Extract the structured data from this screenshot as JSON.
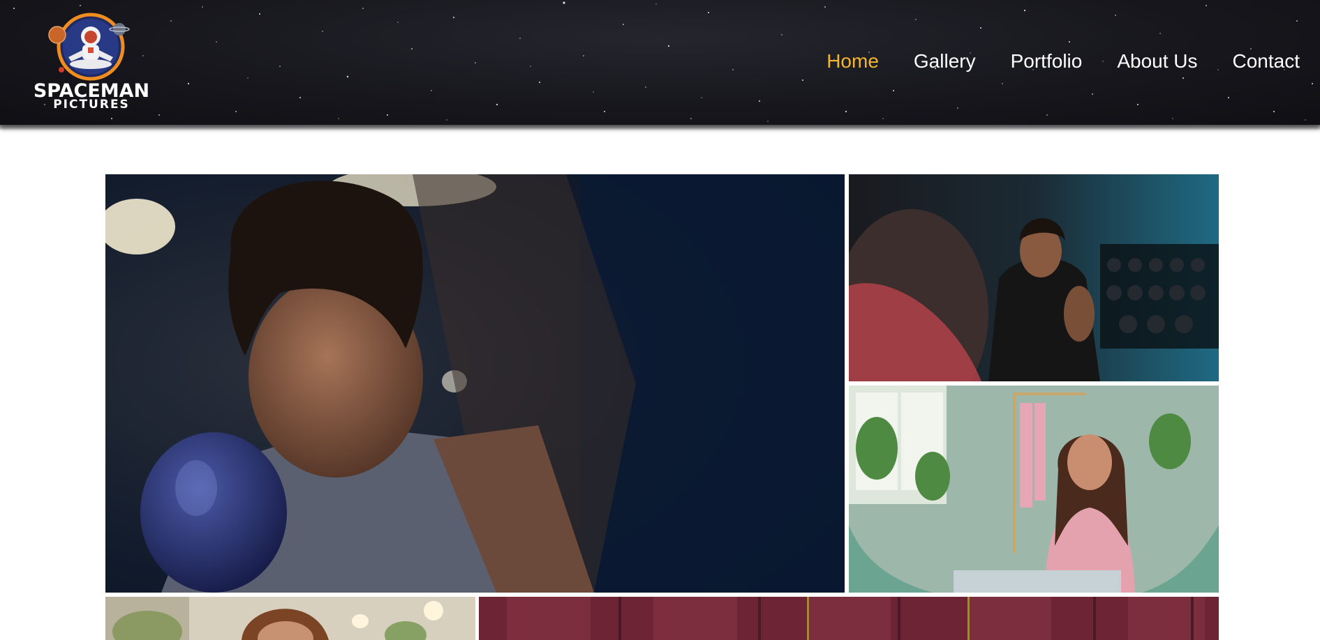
{
  "brand": {
    "name": "SPACEMAN",
    "tagline": "PICTURES",
    "accent_color": "#f4b531",
    "logo_icon": "astronaut-logo-icon"
  },
  "nav": {
    "active_color": "#f4b531",
    "items": [
      {
        "label": "Home",
        "active": true
      },
      {
        "label": "Gallery",
        "active": false
      },
      {
        "label": "Portfolio",
        "active": false
      },
      {
        "label": "About Us",
        "active": false
      },
      {
        "label": "Contact",
        "active": false
      }
    ]
  },
  "gallery": {
    "tiles": [
      {
        "subject": "boxer-with-blue-glove-photo"
      },
      {
        "subject": "man-in-gym-photo"
      },
      {
        "subject": "woman-in-pink-dress-photo"
      },
      {
        "subject": "woman-portrait-photo"
      },
      {
        "subject": "maroon-interior-photo"
      }
    ]
  }
}
